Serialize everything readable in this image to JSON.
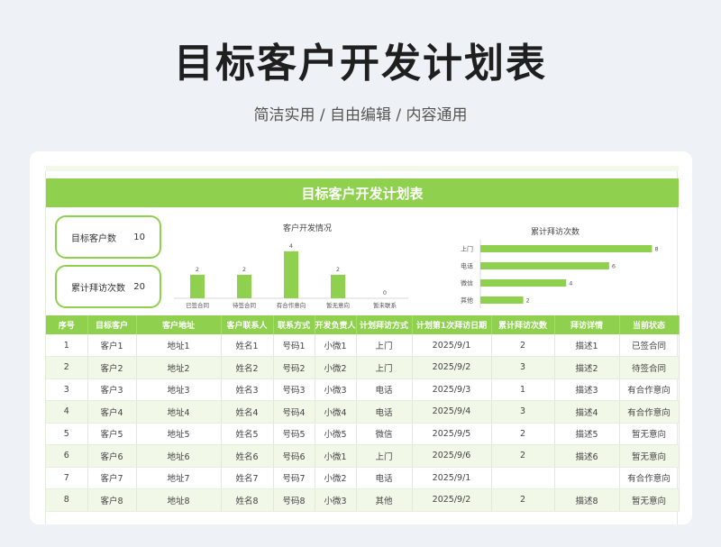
{
  "header": {
    "title": "目标客户开发计划表",
    "subtitle": "简洁实用 / 自由编辑 / 内容通用"
  },
  "sheet": {
    "banner": "目标客户开发计划表",
    "kpis": [
      {
        "label": "目标客户数",
        "value": "10"
      },
      {
        "label": "累计拜访次数",
        "value": "20"
      }
    ]
  },
  "colors": {
    "accent": "#8fd14f"
  },
  "chart_data": [
    {
      "type": "bar",
      "title": "客户开发情况",
      "categories": [
        "已签合同",
        "待签合同",
        "有合作意向",
        "暂无意向",
        "暂未联系"
      ],
      "values": [
        2,
        2,
        4,
        2,
        0
      ],
      "ylim": [
        0,
        4.6
      ],
      "grid": false,
      "legend": "none"
    },
    {
      "type": "bar",
      "orientation": "horizontal",
      "title": "累计拜访次数",
      "categories": [
        "上门",
        "电话",
        "微信",
        "其他"
      ],
      "values": [
        8,
        6,
        4,
        2
      ],
      "xlim": [
        0,
        8.4
      ],
      "grid": false,
      "legend": "none"
    }
  ],
  "table": {
    "columns": [
      "序号",
      "目标客户",
      "客户地址",
      "客户联系人",
      "联系方式",
      "开发负责人",
      "计划拜访方式",
      "计划第1次拜访日期",
      "累计拜访次数",
      "拜访详情",
      "当前状态"
    ],
    "rows": [
      [
        "1",
        "客户1",
        "地址1",
        "姓名1",
        "号码1",
        "小微1",
        "上门",
        "2025/9/1",
        "2",
        "描述1",
        "已签合同"
      ],
      [
        "2",
        "客户2",
        "地址2",
        "姓名2",
        "号码2",
        "小微2",
        "上门",
        "2025/9/2",
        "3",
        "描述2",
        "待签合同"
      ],
      [
        "3",
        "客户3",
        "地址3",
        "姓名3",
        "号码3",
        "小微3",
        "电话",
        "2025/9/3",
        "1",
        "描述3",
        "有合作意向"
      ],
      [
        "4",
        "客户4",
        "地址4",
        "姓名4",
        "号码4",
        "小微4",
        "电话",
        "2025/9/4",
        "3",
        "描述4",
        "有合作意向"
      ],
      [
        "5",
        "客户5",
        "地址5",
        "姓名5",
        "号码5",
        "小微5",
        "微信",
        "2025/9/5",
        "2",
        "描述5",
        "暂无意向"
      ],
      [
        "6",
        "客户6",
        "地址6",
        "姓名6",
        "号码6",
        "小微1",
        "上门",
        "2025/9/6",
        "2",
        "描述6",
        "暂无意向"
      ],
      [
        "7",
        "客户7",
        "地址7",
        "姓名7",
        "号码7",
        "小微2",
        "电话",
        "2025/9/1",
        "",
        "",
        "有合作意向"
      ],
      [
        "8",
        "客户8",
        "地址8",
        "姓名8",
        "号码8",
        "小微3",
        "其他",
        "2025/9/2",
        "2",
        "描述8",
        "暂无意向"
      ]
    ]
  }
}
